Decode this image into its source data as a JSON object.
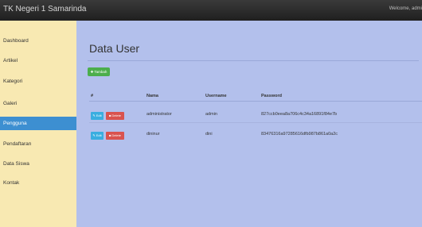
{
  "topbar": {
    "brand": "TK Negeri 1 Samarinda",
    "welcome": "Welcome, admi"
  },
  "sidebar": {
    "items": [
      {
        "label": "Dashboard",
        "active": false
      },
      {
        "label": "Artikel",
        "active": false
      },
      {
        "label": "Kategori",
        "active": false
      },
      {
        "label": "Galeri",
        "active": false
      },
      {
        "label": "Pengguna",
        "active": true
      },
      {
        "label": "Pendaftaran",
        "active": false
      },
      {
        "label": "Data Siswa",
        "active": false
      },
      {
        "label": "Kontak",
        "active": false
      }
    ]
  },
  "main": {
    "title": "Data User",
    "add_button": "Tambah",
    "add_icon": "plus-circle-icon",
    "table": {
      "headers": [
        "#",
        "Nama",
        "Username",
        "Password"
      ],
      "edit_label": "Edit",
      "edit_icon": "edit-icon",
      "delete_label": "Delete",
      "delete_icon": "trash-icon",
      "rows": [
        {
          "nama": "administrator",
          "username": "admin",
          "password": "827ccb0eea8a706c4c34a16891f84e7b"
        },
        {
          "nama": "dininur",
          "username": "dini",
          "password": "83476316a97285616dfb987b861a0a2c"
        }
      ]
    }
  },
  "colors": {
    "topbar": "#2a2a2a",
    "sidebar": "#f8e9b2",
    "sidebar_active": "#3d8fd1",
    "main": "#b3c0ec",
    "add_button": "#4cae4c",
    "edit_button": "#3aaee0",
    "delete_button": "#d9534f"
  }
}
